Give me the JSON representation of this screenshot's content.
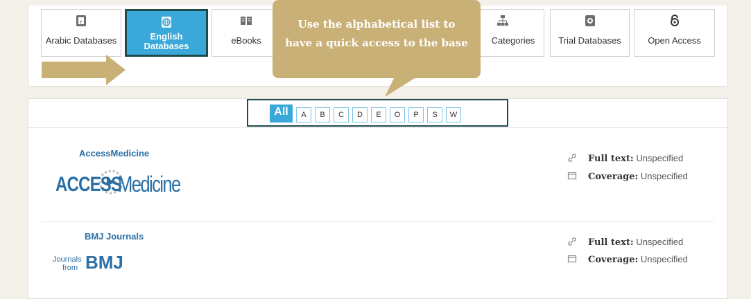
{
  "tabs": [
    {
      "label": "Arabic Databases",
      "icon": "database-icon",
      "active": false
    },
    {
      "label": "English Databases",
      "icon": "globe-database-icon",
      "active": true
    },
    {
      "label": "eBooks",
      "icon": "book-icon",
      "active": false
    },
    {
      "label": "Categories",
      "icon": "hierarchy-icon",
      "active": false
    },
    {
      "label": "Trial Databases",
      "icon": "trial-database-icon",
      "active": false
    },
    {
      "label": "Open Access",
      "icon": "open-access-icon",
      "active": false
    }
  ],
  "callout": {
    "line1": "Use the alphabetical list to",
    "line2": "have a quick access to the base"
  },
  "letters": {
    "all": "All",
    "items": [
      "A",
      "B",
      "C",
      "D",
      "E",
      "O",
      "P",
      "S",
      "W"
    ]
  },
  "databases": [
    {
      "title": "AccessMedicine",
      "logo_main": "ACCESS",
      "logo_second": "Medicine",
      "full_text_label": "Full text:",
      "full_text_value": "Unspecified",
      "coverage_label": "Coverage:",
      "coverage_value": "Unspecified"
    },
    {
      "title": "BMJ Journals",
      "logo_small_1": "Journals",
      "logo_small_2": "from",
      "logo_main": "BMJ",
      "full_text_label": "Full text:",
      "full_text_value": "Unspecified",
      "coverage_label": "Coverage:",
      "coverage_value": "Unspecified"
    }
  ],
  "colors": {
    "accent": "#3aa8d8",
    "callout": "#c9b077",
    "highlight_border": "#1f4b4d",
    "link": "#2a6fa6"
  }
}
